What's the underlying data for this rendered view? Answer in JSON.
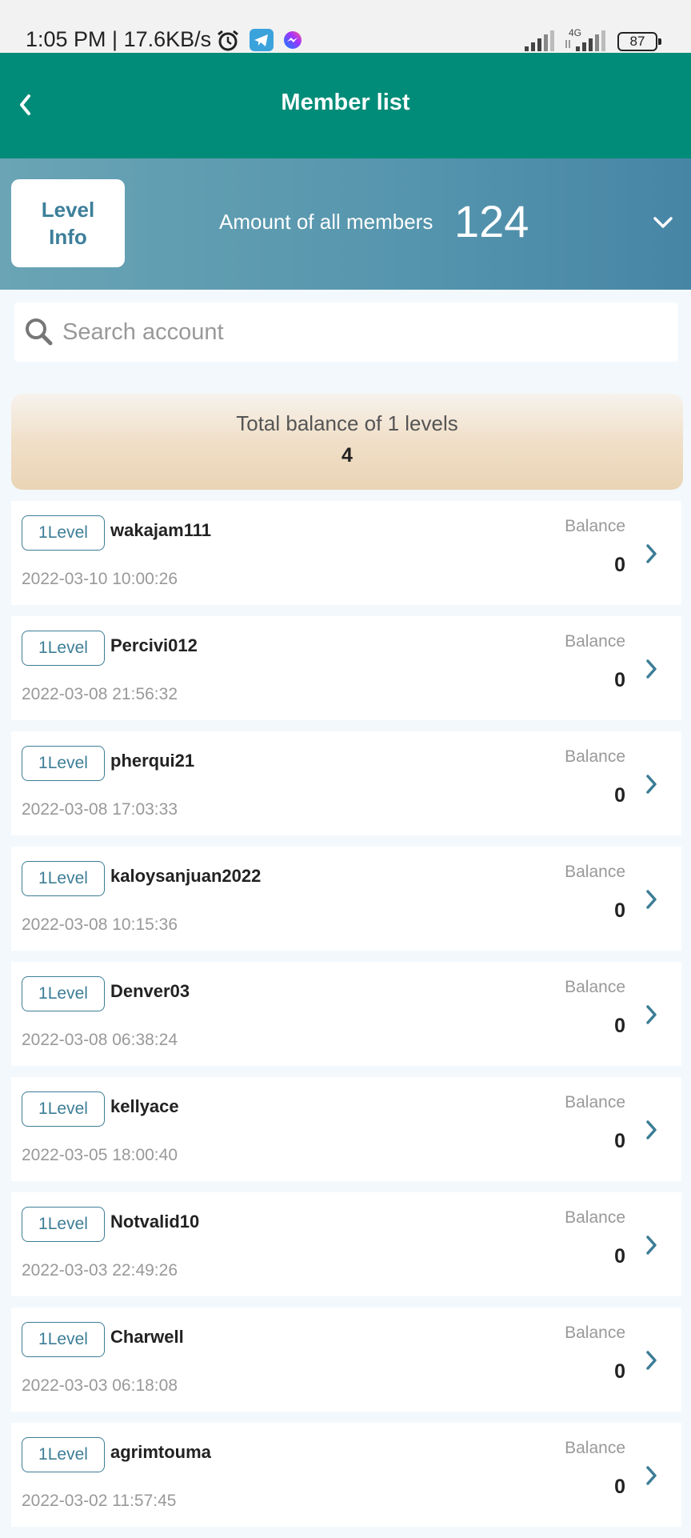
{
  "status_bar": {
    "text": "1:05 PM | 17.6KB/s",
    "network": "4G",
    "battery": "87",
    "icons": [
      "alarm-icon",
      "telegram-icon",
      "messenger-icon",
      "signal-icon",
      "signal-icon",
      "battery-icon"
    ]
  },
  "header": {
    "title": "Member list",
    "back_icon": "chevron-left-icon"
  },
  "banner": {
    "level_info_label": "Level Info",
    "members_label": "Amount of all members",
    "members_count": "124",
    "dropdown_icon": "chevron-down-icon"
  },
  "search": {
    "placeholder": "Search account",
    "value": ""
  },
  "total": {
    "label": "Total balance of 1 levels",
    "value": "4"
  },
  "members": [
    {
      "level": "1Level",
      "name": "wakajam111",
      "date": "2022-03-10 10:00:26",
      "balance_label": "Balance",
      "balance": "0"
    },
    {
      "level": "1Level",
      "name": "Percivi012",
      "date": "2022-03-08 21:56:32",
      "balance_label": "Balance",
      "balance": "0"
    },
    {
      "level": "1Level",
      "name": "pherqui21",
      "date": "2022-03-08 17:03:33",
      "balance_label": "Balance",
      "balance": "0"
    },
    {
      "level": "1Level",
      "name": "kaloysanjuan2022",
      "date": "2022-03-08 10:15:36",
      "balance_label": "Balance",
      "balance": "0"
    },
    {
      "level": "1Level",
      "name": "Denver03",
      "date": "2022-03-08 06:38:24",
      "balance_label": "Balance",
      "balance": "0"
    },
    {
      "level": "1Level",
      "name": "kellyace",
      "date": "2022-03-05 18:00:40",
      "balance_label": "Balance",
      "balance": "0"
    },
    {
      "level": "1Level",
      "name": "Notvalid10",
      "date": "2022-03-03 22:49:26",
      "balance_label": "Balance",
      "balance": "0"
    },
    {
      "level": "1Level",
      "name": "Charwell",
      "date": "2022-03-03 06:18:08",
      "balance_label": "Balance",
      "balance": "0"
    },
    {
      "level": "1Level",
      "name": "agrimtouma",
      "date": "2022-03-02 11:57:45",
      "balance_label": "Balance",
      "balance": "0"
    }
  ],
  "colors": {
    "header": "#008c78",
    "banner": "#5595ad",
    "accent": "#3c7d96",
    "total_card": "#ead4b5"
  }
}
